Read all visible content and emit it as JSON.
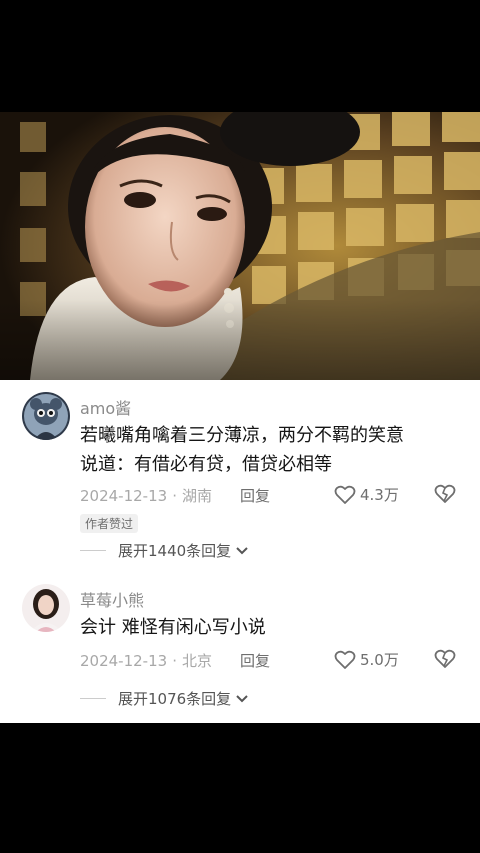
{
  "video": {
    "description_icon": "drama-still-image"
  },
  "comments": [
    {
      "username": "amo酱",
      "text_line1": "若曦嘴角噙着三分薄凉，两分不羁的笑意",
      "text_line2": "说道：有借必有贷，借贷必相等",
      "date": "2024-12-13",
      "separator": "·",
      "location": "湖南",
      "reply_label": "回复",
      "likes": "4.3万",
      "badge": "作者赞过",
      "expand_label": "展开1440条回复"
    },
    {
      "username": "草莓小熊",
      "text_line1": "会计 难怪有闲心写小说",
      "date": "2024-12-13",
      "separator": "·",
      "location": "北京",
      "reply_label": "回复",
      "likes": "5.0万",
      "expand_label": "展开1076条回复"
    }
  ]
}
